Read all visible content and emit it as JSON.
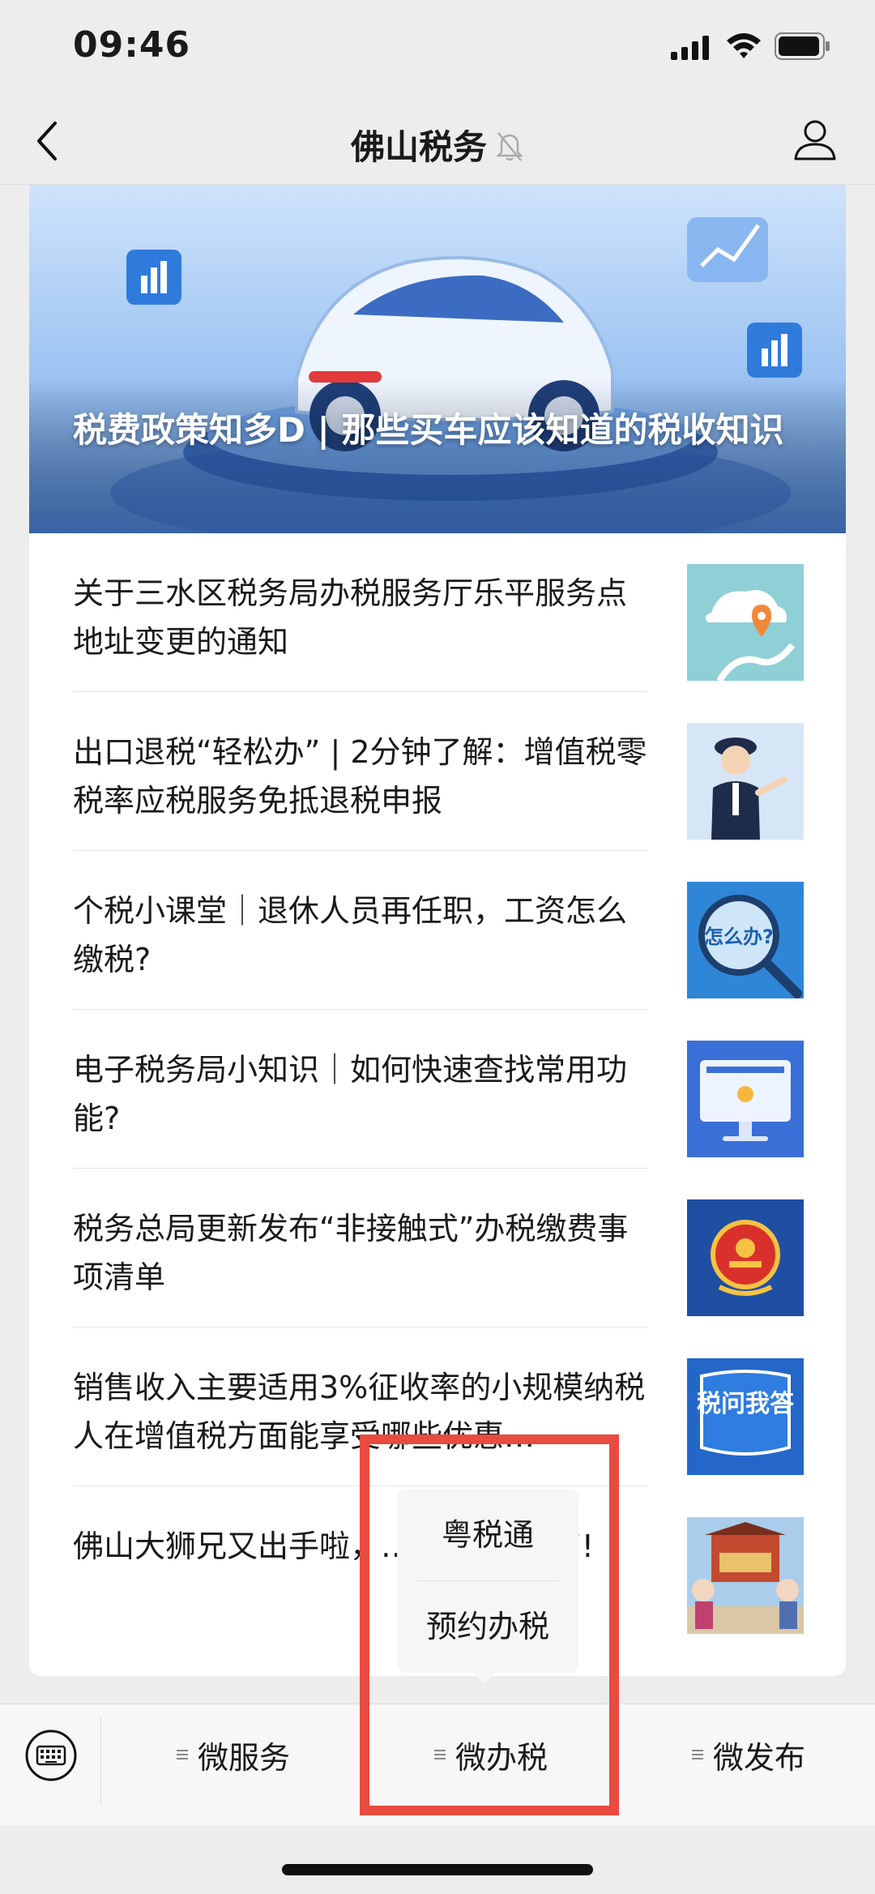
{
  "status_bar": {
    "time": "09:46",
    "icons": [
      "signal-icon",
      "wifi-icon",
      "battery-icon"
    ]
  },
  "nav": {
    "title": "佛山税务",
    "icons": [
      "back-icon",
      "mute-icon",
      "profile-icon"
    ]
  },
  "hero": {
    "title": "税费政策知多D | 那些买车应该知道的税收知识"
  },
  "articles": [
    {
      "title": "关于三水区税务局办税服务厅乐平服务点地址变更的通知",
      "thumb_icon": "map-pin-icon",
      "thumb_color": "#7ec3cf"
    },
    {
      "title": "出口退税“轻松办” | 2分钟了解：增值税零税率应税服务免抵退税申报",
      "thumb_icon": "officer-icon",
      "thumb_color": "#cfe0f5"
    },
    {
      "title": "个税小课堂｜退休人员再任职，工资怎么缴税?",
      "thumb_icon": "magnifier-icon",
      "thumb_color": "#2f86d6",
      "thumb_text": "怎么办?"
    },
    {
      "title": "电子税务局小知识｜如何快速查找常用功能?",
      "thumb_icon": "monitor-icon",
      "thumb_color": "#3a6fd8"
    },
    {
      "title": "税务总局更新发布“非接触式”办税缴费事项清单",
      "thumb_icon": "emblem-icon",
      "thumb_color": "#1f4fa3"
    },
    {
      "title": "销售收入主要适用3%征收率的小规模纳税人在增值税方面能享受哪些优惠…",
      "thumb_icon": "tax-qa-icon",
      "thumb_color": "#2467c9",
      "thumb_text": "税问我答"
    },
    {
      "title": "佛山大狮兄又出手啦，……网络水军”!",
      "thumb_icon": "lion-dance-icon",
      "thumb_color": "#9fc6e8"
    }
  ],
  "popup_menu": {
    "items": [
      "粤税通",
      "预约办税"
    ]
  },
  "bottom_menu": {
    "tabs": [
      "微服务",
      "微办税",
      "微发布"
    ],
    "icons": [
      "keyboard-icon",
      "menu-icon"
    ]
  },
  "colors": {
    "highlight": "#e84b3f",
    "background": "#ededed"
  }
}
